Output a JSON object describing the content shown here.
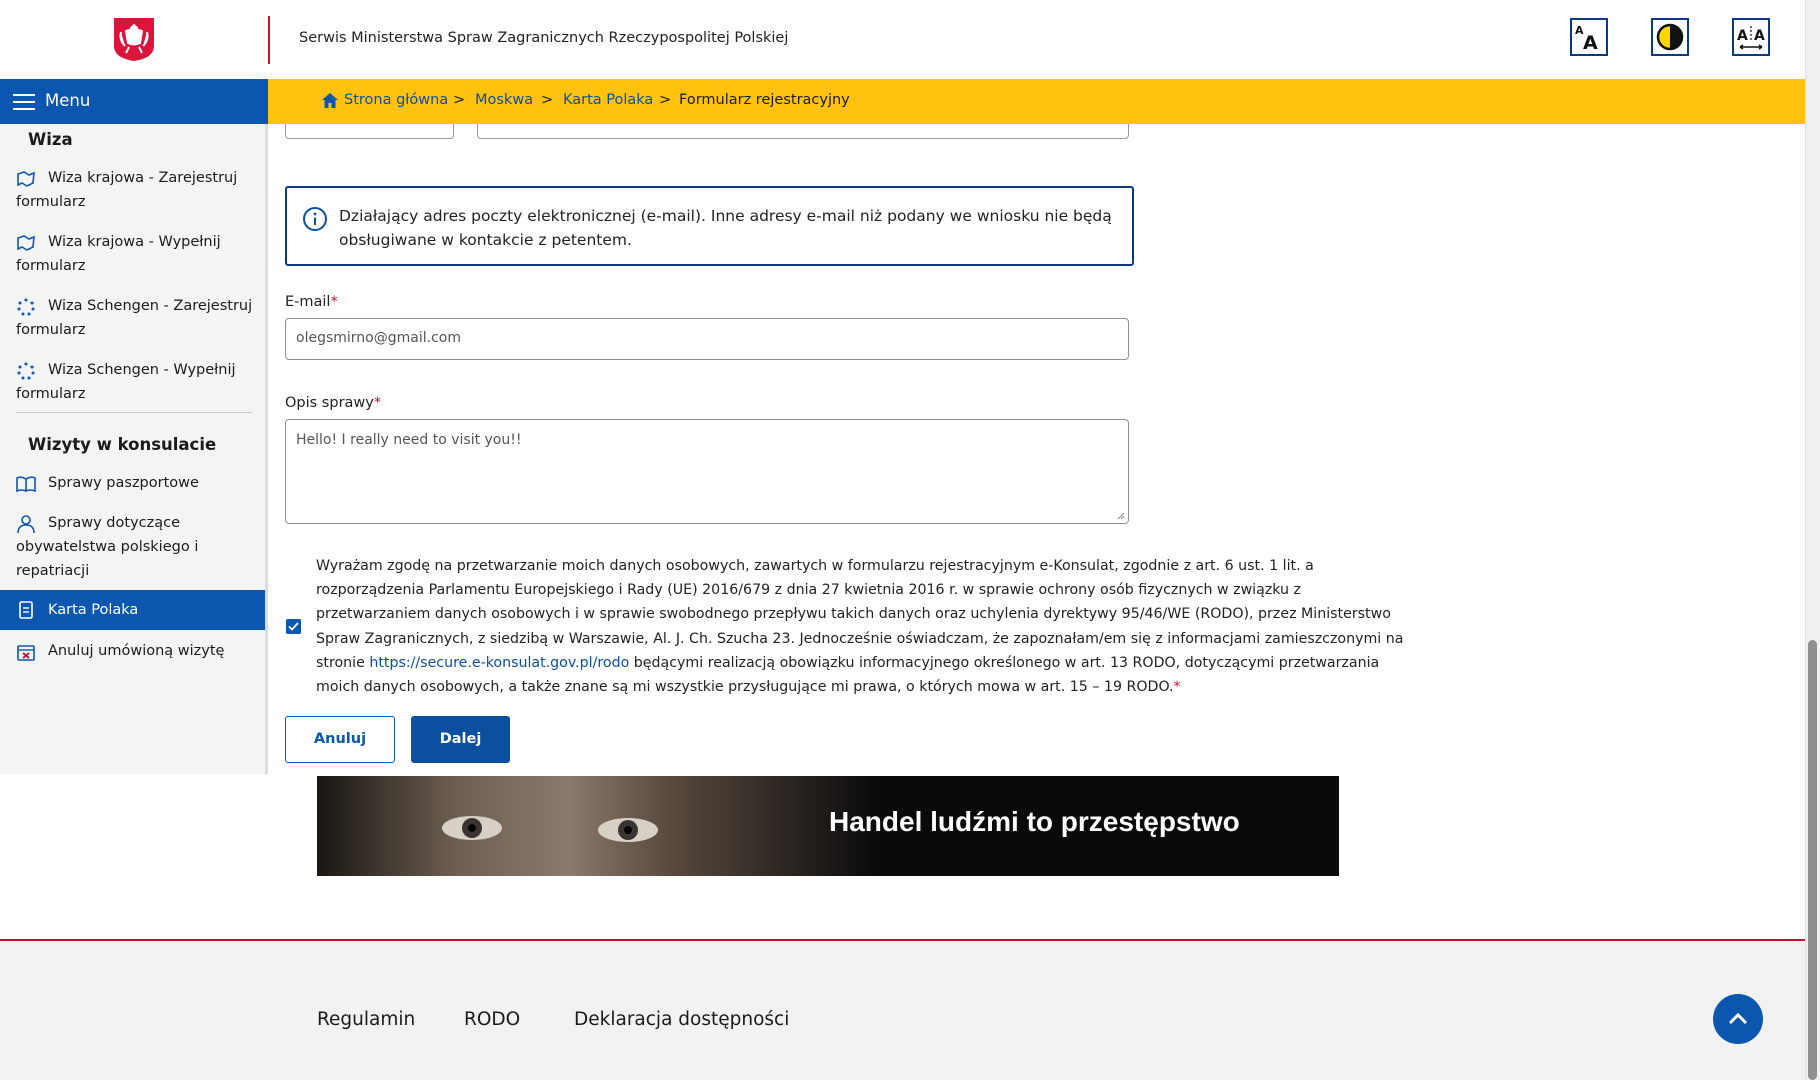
{
  "header": {
    "site_title": "Serwis Ministerstwa Spraw Zagranicznych Rzeczypospolitej Polskiej",
    "tools": [
      "text-size-icon",
      "contrast-icon",
      "letter-spacing-icon"
    ]
  },
  "menu": {
    "label": "Menu"
  },
  "breadcrumb": [
    {
      "label": "Strona główna"
    },
    {
      "label": "Moskwa"
    },
    {
      "label": "Karta Polaka"
    },
    {
      "label": "Formularz rejestracyjny"
    }
  ],
  "breadcrumb_sep": ">",
  "sidebar": {
    "section1": "Wiza",
    "section2": "Wizyty w konsulacie",
    "items": [
      {
        "label": "Wiza krajowa -  Zarejestruj formularz",
        "icon": "map-outline-icon"
      },
      {
        "label": "Wiza krajowa -  Wypełnij formularz",
        "icon": "map-outline-icon"
      },
      {
        "label": "Wiza Schengen -  Zarejestruj formularz",
        "icon": "eu-stars-icon"
      },
      {
        "label": "Wiza Schengen -  Wypełnij formularz",
        "icon": "eu-stars-icon"
      },
      {
        "label": "Sprawy paszportowe",
        "icon": "book-icon"
      },
      {
        "label": "Sprawy dotyczące obywatelstwa polskiego i repatriacji",
        "icon": "person-icon"
      },
      {
        "label": "Karta Polaka",
        "icon": "card-icon",
        "active": true
      },
      {
        "label": "Anuluj umówioną wizytę",
        "icon": "calendar-cancel-icon"
      }
    ]
  },
  "form": {
    "info_text": "Działający adres poczty elektronicznej (e-mail). Inne adresy e-mail niż podany we wniosku nie będą obsługiwane w kontakcie z petentem.",
    "email_label": "E-mail",
    "email_value": "olegsmirno@gmail.com",
    "description_label": "Opis sprawy",
    "description_value": "Hello! I really need to visit you!!",
    "required_mark": "*",
    "consent_checked": true,
    "consent_text_before": "Wyrażam zgodę na przetwarzanie moich danych osobowych, zawartych w formularzu rejestracyjnym e-Konsulat, zgodnie z art. 6 ust. 1 lit. a rozporządzenia Parlamentu Europejskiego i Rady (UE) 2016/679 z dnia 27 kwietnia 2016 r. w sprawie ochrony osób fizycznych w związku z przetwarzaniem danych osobowych i w sprawie swobodnego przepływu takich danych oraz uchylenia dyrektywy 95/46/WE (RODO), przez Ministerstwo Spraw Zagranicznych, z siedzibą w Warszawie, Al. J. Ch. Szucha 23. Jednocześnie oświadczam, że zapoznałam/em się z informacjami zamieszczonymi na stronie ",
    "consent_link": "https://secure.e-konsulat.gov.pl/rodo",
    "consent_text_after": " będącymi realizacją obowiązku informacyjnego określonego w art. 13 RODO, dotyczącymi przetwarzania moich danych osobowych, a także znane są mi wszystkie przysługujące mi prawa, o których mowa w art. 15 – 19 RODO.",
    "cancel_label": "Anuluj",
    "next_label": "Dalej"
  },
  "banner": {
    "text": "Handel ludźmi to przestępstwo"
  },
  "footer": {
    "links": [
      "Regulamin",
      "RODO",
      "Deklaracja dostępności"
    ]
  },
  "colors": {
    "primary": "#0b57b0",
    "accent": "#ffc20e",
    "red": "#c4122f"
  }
}
